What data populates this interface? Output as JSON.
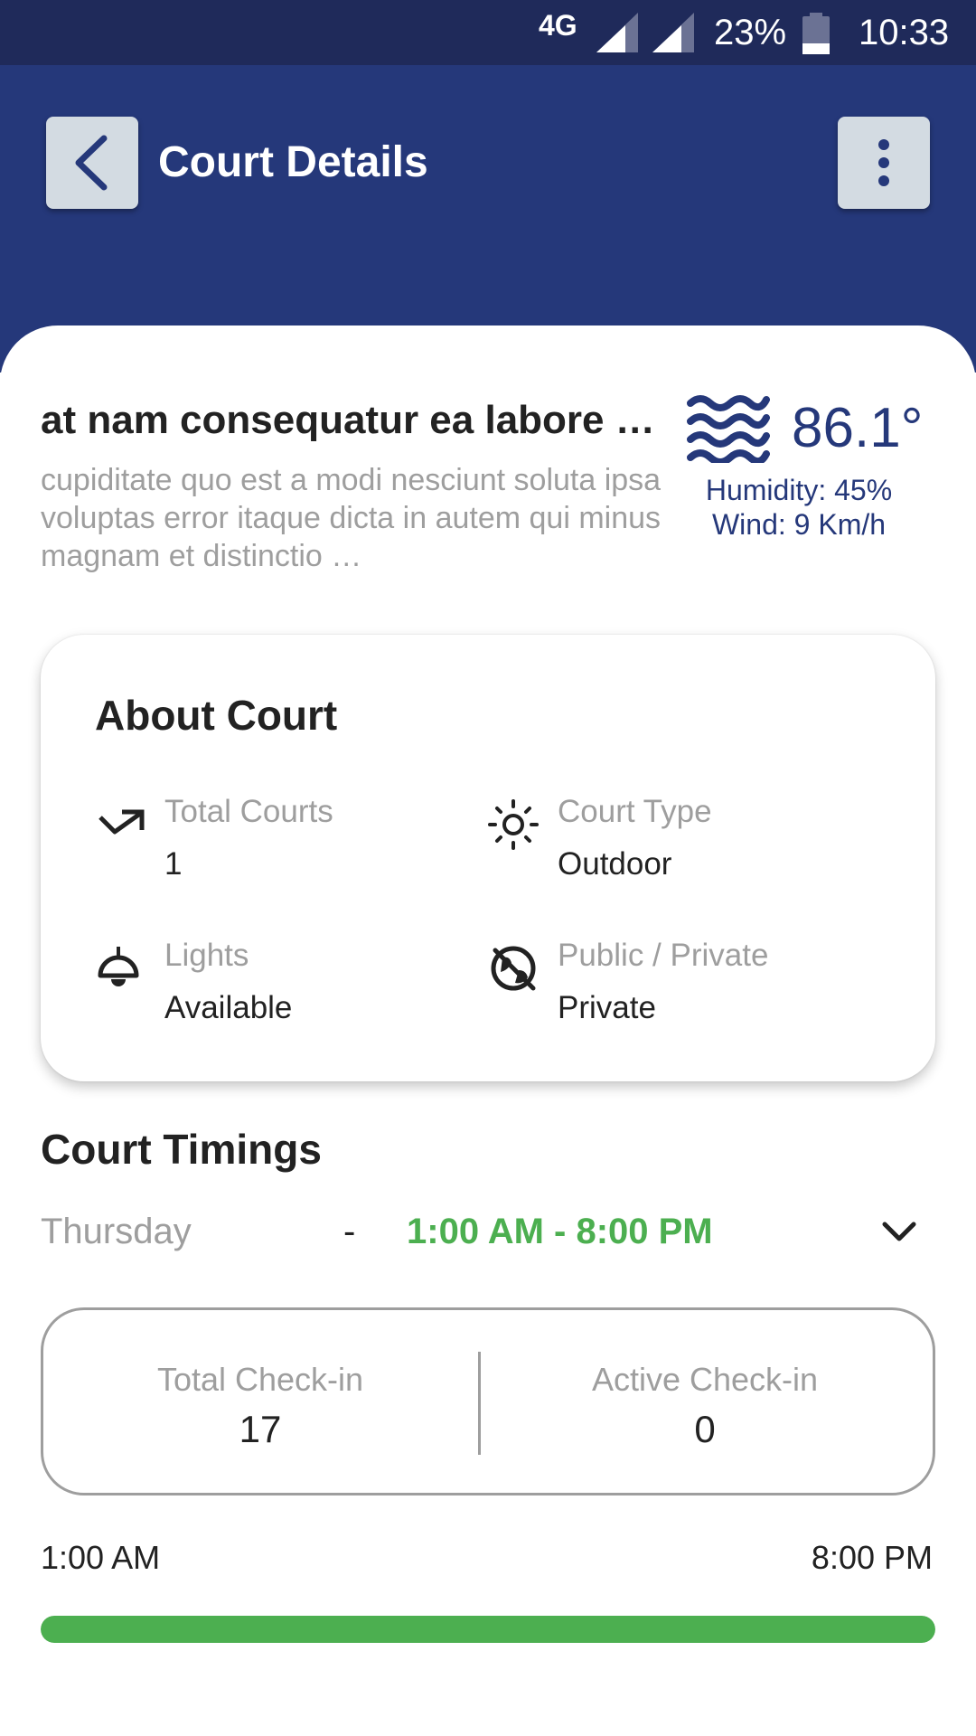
{
  "status_bar": {
    "network": "4G",
    "battery": "23%",
    "time": "10:33"
  },
  "header": {
    "title": "Court Details",
    "back_icon": "chevron-left-icon",
    "menu_icon": "more-vert-icon"
  },
  "court": {
    "name": "at nam consequatur ea labore …",
    "description": "cupiditate quo est a modi nesciunt soluta ipsa voluptas error itaque dicta in autem qui minus magnam et distinctio …"
  },
  "weather": {
    "icon": "waves-icon",
    "temperature": "86.1°",
    "humidity": "Humidity: 45%",
    "wind": "Wind: 9 Km/h"
  },
  "about": {
    "title": "About Court",
    "items": [
      {
        "icon": "trend-arrow-icon",
        "label": "Total Courts",
        "value": "1"
      },
      {
        "icon": "sun-icon",
        "label": "Court Type",
        "value": "Outdoor"
      },
      {
        "icon": "ceiling-light-icon",
        "label": "Lights",
        "value": "Available"
      },
      {
        "icon": "public-off-icon",
        "label": "Public / Private",
        "value": "Private"
      }
    ]
  },
  "timings": {
    "title": "Court Timings",
    "day": "Thursday",
    "separator": "-",
    "hours": "1:00 AM - 8:00 PM"
  },
  "checkin": {
    "total_label": "Total Check-in",
    "total_value": "17",
    "active_label": "Active Check-in",
    "active_value": "0"
  },
  "progress": {
    "start": "1:00 AM",
    "end": "8:00 PM",
    "fraction": 1.0
  },
  "colors": {
    "header": "#25387a",
    "status_bar": "#1f2a5a",
    "accent_green": "#4caf50",
    "muted_text": "#9e9e9e"
  }
}
